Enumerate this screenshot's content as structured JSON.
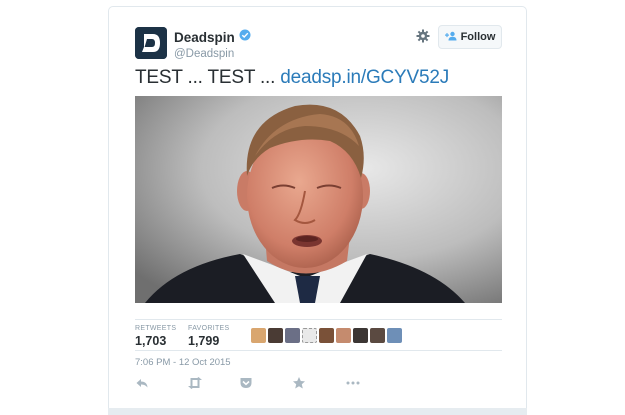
{
  "account": {
    "name": "Deadspin",
    "handle": "@Deadspin"
  },
  "follow_button": {
    "label": "Follow"
  },
  "tweet": {
    "text_prefix": "TEST ... TEST ... ",
    "link_text": "deadsp.in/GCYV52J",
    "timestamp": "7:06 PM - 12 Oct 2015"
  },
  "stats": {
    "retweets": {
      "label": "RETWEETS",
      "value": "1,703"
    },
    "favorites": {
      "label": "FAVORITES",
      "value": "1,799"
    }
  },
  "colors": {
    "link": "#2b7bb9",
    "verified": "#55acee",
    "text": "#292f33",
    "muted": "#8899a6",
    "border": "#e1e8ed"
  },
  "icons": [
    "verified-icon",
    "gear-icon",
    "follow-person-icon",
    "reply-icon",
    "retweet-icon",
    "pocket-icon",
    "favorite-star-icon",
    "more-icon"
  ]
}
